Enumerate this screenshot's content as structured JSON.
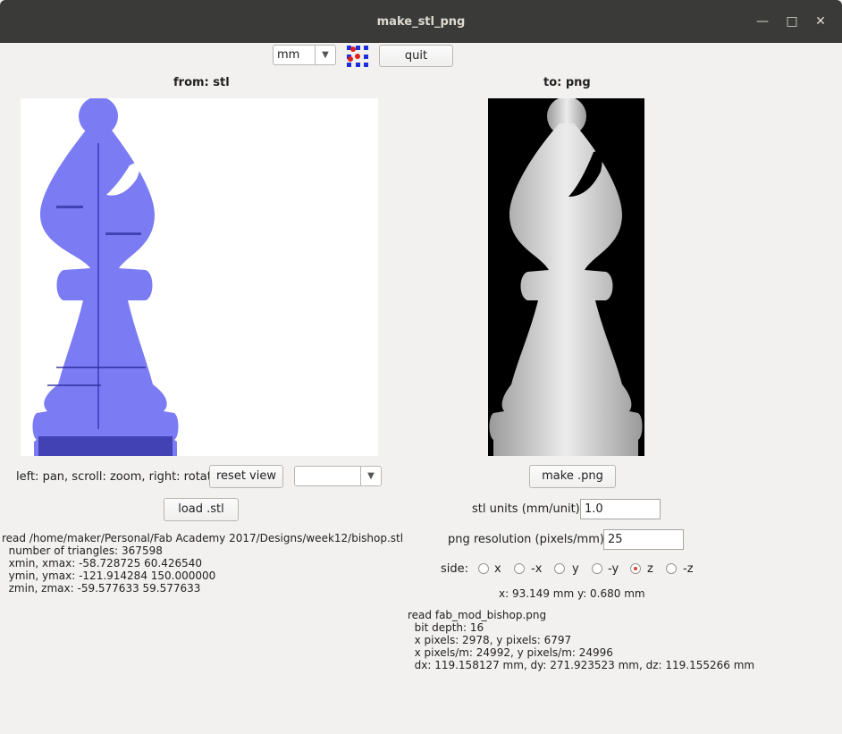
{
  "window": {
    "title": "make_stl_png"
  },
  "toolbar": {
    "units_value": "mm",
    "quit_label": "quit",
    "logo_icon": "fab-logo-icon"
  },
  "left": {
    "heading": "from: stl",
    "hint": "left: pan, scroll: zoom, right: rotate",
    "reset_label": "reset view",
    "view_combo_value": "",
    "load_label": "load .stl",
    "info": [
      "read /home/maker/Personal/Fab Academy 2017/Designs/week12/bishop.stl",
      "  number of triangles: 367598",
      "  xmin, xmax: -58.728725 60.426540",
      "  ymin, ymax: -121.914284 150.000000",
      "  zmin, zmax: -59.577633 59.577633"
    ]
  },
  "right": {
    "heading": "to: png",
    "make_label": "make .png",
    "units_label": "stl units (mm/unit):",
    "units_value": "1.0",
    "res_label": "png resolution (pixels/mm):",
    "res_value": "25",
    "side_label": "side:",
    "sides": [
      {
        "label": "x",
        "checked": false
      },
      {
        "label": "-x",
        "checked": false
      },
      {
        "label": "y",
        "checked": false
      },
      {
        "label": "-y",
        "checked": false
      },
      {
        "label": "z",
        "checked": true
      },
      {
        "label": "-z",
        "checked": false
      }
    ],
    "coords": "x: 93.149 mm  y: 0.680 mm",
    "info": [
      "read fab_mod_bishop.png",
      "  bit depth: 16",
      "  x pixels: 2978, y pixels: 6797",
      "  x pixels/m: 24992, y pixels/m: 24996",
      "  dx: 119.158127 mm, dy: 271.923523 mm, dz: 119.155266 mm"
    ]
  },
  "colors": {
    "stl_blue": "#7b7bf4",
    "titlebar": "#3a3a38"
  }
}
